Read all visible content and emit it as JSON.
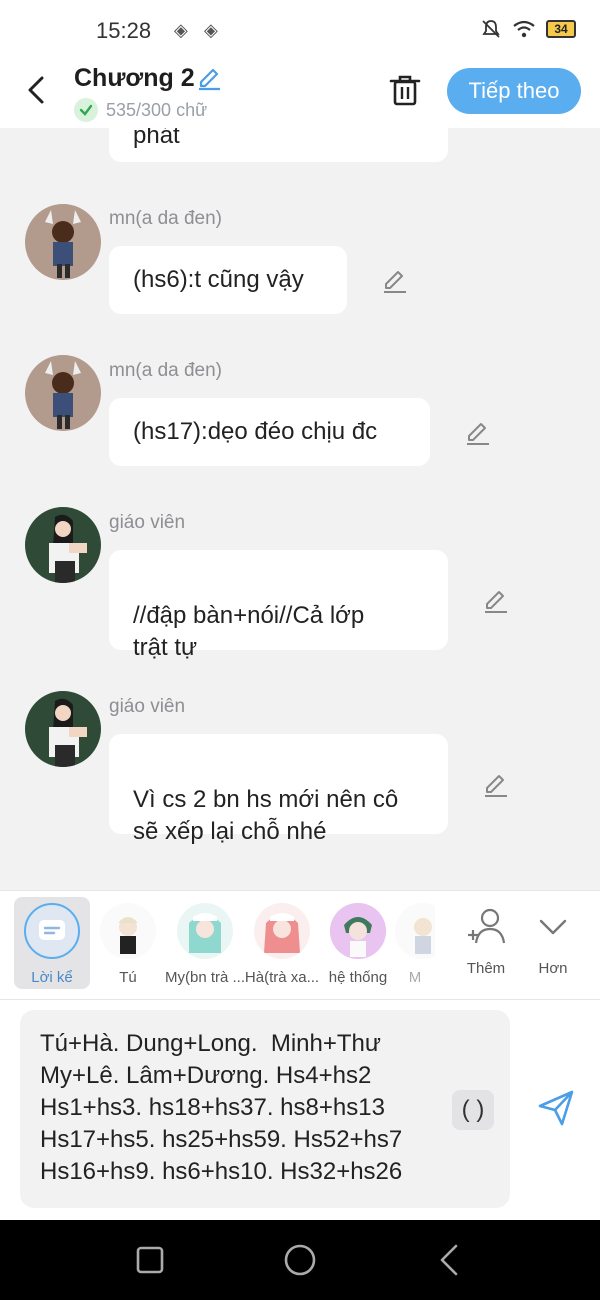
{
  "status": {
    "time": "15:28",
    "battery": "34"
  },
  "header": {
    "title": "Chương 2",
    "word_count": "535/300 chữ",
    "next_label": "Tiếp theo"
  },
  "messages": [
    {
      "sender": "",
      "text": "phát"
    },
    {
      "sender": "mn(a da đen)",
      "text": "(hs6):t cũng vậy"
    },
    {
      "sender": "mn(a da đen)",
      "text": "(hs17):dẹo đéo chịu đc"
    },
    {
      "sender": "giáo viên",
      "text": "//đập bàn+nói//Cả lớp\ntrật tự"
    },
    {
      "sender": "giáo viên",
      "text": "Vì cs 2 bn hs mới nên cô\nsẽ xếp lại chỗ nhé"
    }
  ],
  "characters": [
    {
      "label": "Lời kể"
    },
    {
      "label": "Tú"
    },
    {
      "label": "My(bn trà ..."
    },
    {
      "label": "Hà(trà xa..."
    },
    {
      "label": "hệ thống"
    },
    {
      "label": "M"
    }
  ],
  "actions": {
    "add_label": "Thêm",
    "more_label": "Hơn"
  },
  "composer": {
    "text": "Tú+Hà. Dung+Long.  Minh+Thư\nMy+Lê. Lâm+Dương. Hs4+hs2\nHs1+hs3. hs18+hs37. hs8+hs13\nHs17+hs5. hs25+hs59. Hs52+hs7\nHs16+hs9. hs6+hs10. Hs32+hs26",
    "paren_label": "( )"
  }
}
